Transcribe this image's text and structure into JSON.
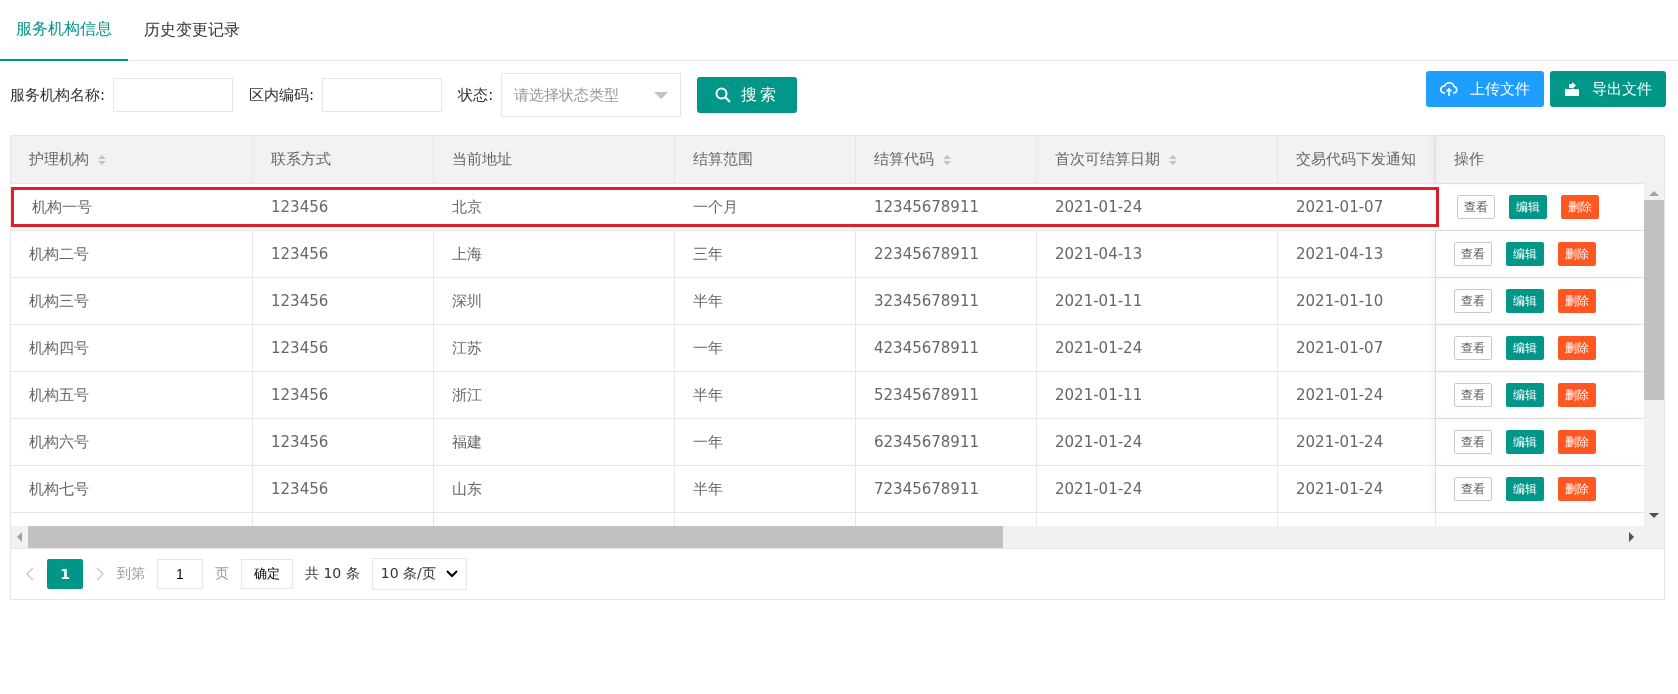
{
  "tabs": [
    {
      "label": "服务机构信息",
      "selected": true
    },
    {
      "label": "历史变更记录",
      "selected": false
    }
  ],
  "filters": [
    {
      "kind": "input",
      "label": "服务机构名称:"
    },
    {
      "kind": "input",
      "label": "区内编码:"
    },
    {
      "kind": "select",
      "label": "状态:",
      "placeholder": "请选择状态类型"
    }
  ],
  "search_button": "搜索",
  "toolbar_buttons": [
    {
      "kind": "upload",
      "label": "上传文件"
    },
    {
      "kind": "export",
      "label": "导出文件"
    }
  ],
  "table": {
    "columns": [
      {
        "label": "护理机构",
        "sortable": true
      },
      {
        "label": "联系方式"
      },
      {
        "label": "当前地址"
      },
      {
        "label": "结算范围"
      },
      {
        "label": "结算代码",
        "sortable": true
      },
      {
        "label": "首次可结算日期",
        "sortable": true
      },
      {
        "label": "交易代码下发通知"
      }
    ],
    "action_column": "操作",
    "rows": [
      {
        "highlighted": true,
        "cells": [
          "机构一号",
          "123456",
          "北京",
          "一个月",
          "12345678911",
          "2021-01-24",
          "2021-01-07"
        ],
        "actions": [
          {
            "kind": "view",
            "label": "查看"
          },
          {
            "kind": "edit",
            "label": "编辑"
          },
          {
            "kind": "delete",
            "label": "删除"
          }
        ]
      },
      {
        "highlighted": false,
        "cells": [
          "机构二号",
          "123456",
          "上海",
          "三年",
          "22345678911",
          "2021-04-13",
          "2021-04-13"
        ],
        "actions": [
          {
            "kind": "view",
            "label": "查看"
          },
          {
            "kind": "edit",
            "label": "编辑"
          },
          {
            "kind": "delete",
            "label": "删除"
          }
        ]
      },
      {
        "highlighted": false,
        "cells": [
          "机构三号",
          "123456",
          "深圳",
          "半年",
          "32345678911",
          "2021-01-11",
          "2021-01-10"
        ],
        "actions": [
          {
            "kind": "view",
            "label": "查看"
          },
          {
            "kind": "edit",
            "label": "编辑"
          },
          {
            "kind": "delete",
            "label": "删除"
          }
        ]
      },
      {
        "highlighted": false,
        "cells": [
          "机构四号",
          "123456",
          "江苏",
          "一年",
          "42345678911",
          "2021-01-24",
          "2021-01-07"
        ],
        "actions": [
          {
            "kind": "view",
            "label": "查看"
          },
          {
            "kind": "edit",
            "label": "编辑"
          },
          {
            "kind": "delete",
            "label": "删除"
          }
        ]
      },
      {
        "highlighted": false,
        "cells": [
          "机构五号",
          "123456",
          "浙江",
          "半年",
          "52345678911",
          "2021-01-11",
          "2021-01-24"
        ],
        "actions": [
          {
            "kind": "view",
            "label": "查看"
          },
          {
            "kind": "edit",
            "label": "编辑"
          },
          {
            "kind": "delete",
            "label": "删除"
          }
        ]
      },
      {
        "highlighted": false,
        "cells": [
          "机构六号",
          "123456",
          "福建",
          "一年",
          "62345678911",
          "2021-01-24",
          "2021-01-24"
        ],
        "actions": [
          {
            "kind": "view",
            "label": "查看"
          },
          {
            "kind": "edit",
            "label": "编辑"
          },
          {
            "kind": "delete",
            "label": "删除"
          }
        ]
      },
      {
        "highlighted": false,
        "cells": [
          "机构七号",
          "123456",
          "山东",
          "半年",
          "72345678911",
          "2021-01-24",
          "2021-01-24"
        ],
        "actions": [
          {
            "kind": "view",
            "label": "查看"
          },
          {
            "kind": "edit",
            "label": "编辑"
          },
          {
            "kind": "delete",
            "label": "删除"
          }
        ]
      }
    ]
  },
  "pagination": {
    "current_page": "1",
    "goto_label": "到第",
    "goto_value": "1",
    "page_unit": "页",
    "confirm": "确定",
    "total": "共 10 条",
    "page_size": "10 条/页"
  }
}
